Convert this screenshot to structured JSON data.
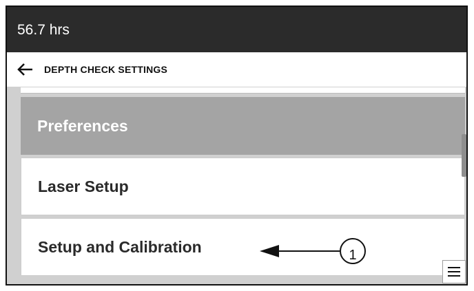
{
  "status": {
    "runtime": "56.7 hrs"
  },
  "header": {
    "title": "DEPTH CHECK SETTINGS",
    "back_icon": "back-arrow-icon"
  },
  "menu": {
    "items": [
      {
        "label": "Preferences",
        "selected": true
      },
      {
        "label": "Laser Setup",
        "selected": false
      },
      {
        "label": "Setup and Calibration",
        "selected": false
      }
    ]
  },
  "annotation": {
    "callout_number": "1"
  },
  "colors": {
    "status_bar": "#2b2b2b",
    "selected_item": "#a4a4a4",
    "item_background": "#ffffff",
    "list_background": "#d0d0d0"
  },
  "icons": {
    "menu": "hamburger-menu-icon"
  }
}
